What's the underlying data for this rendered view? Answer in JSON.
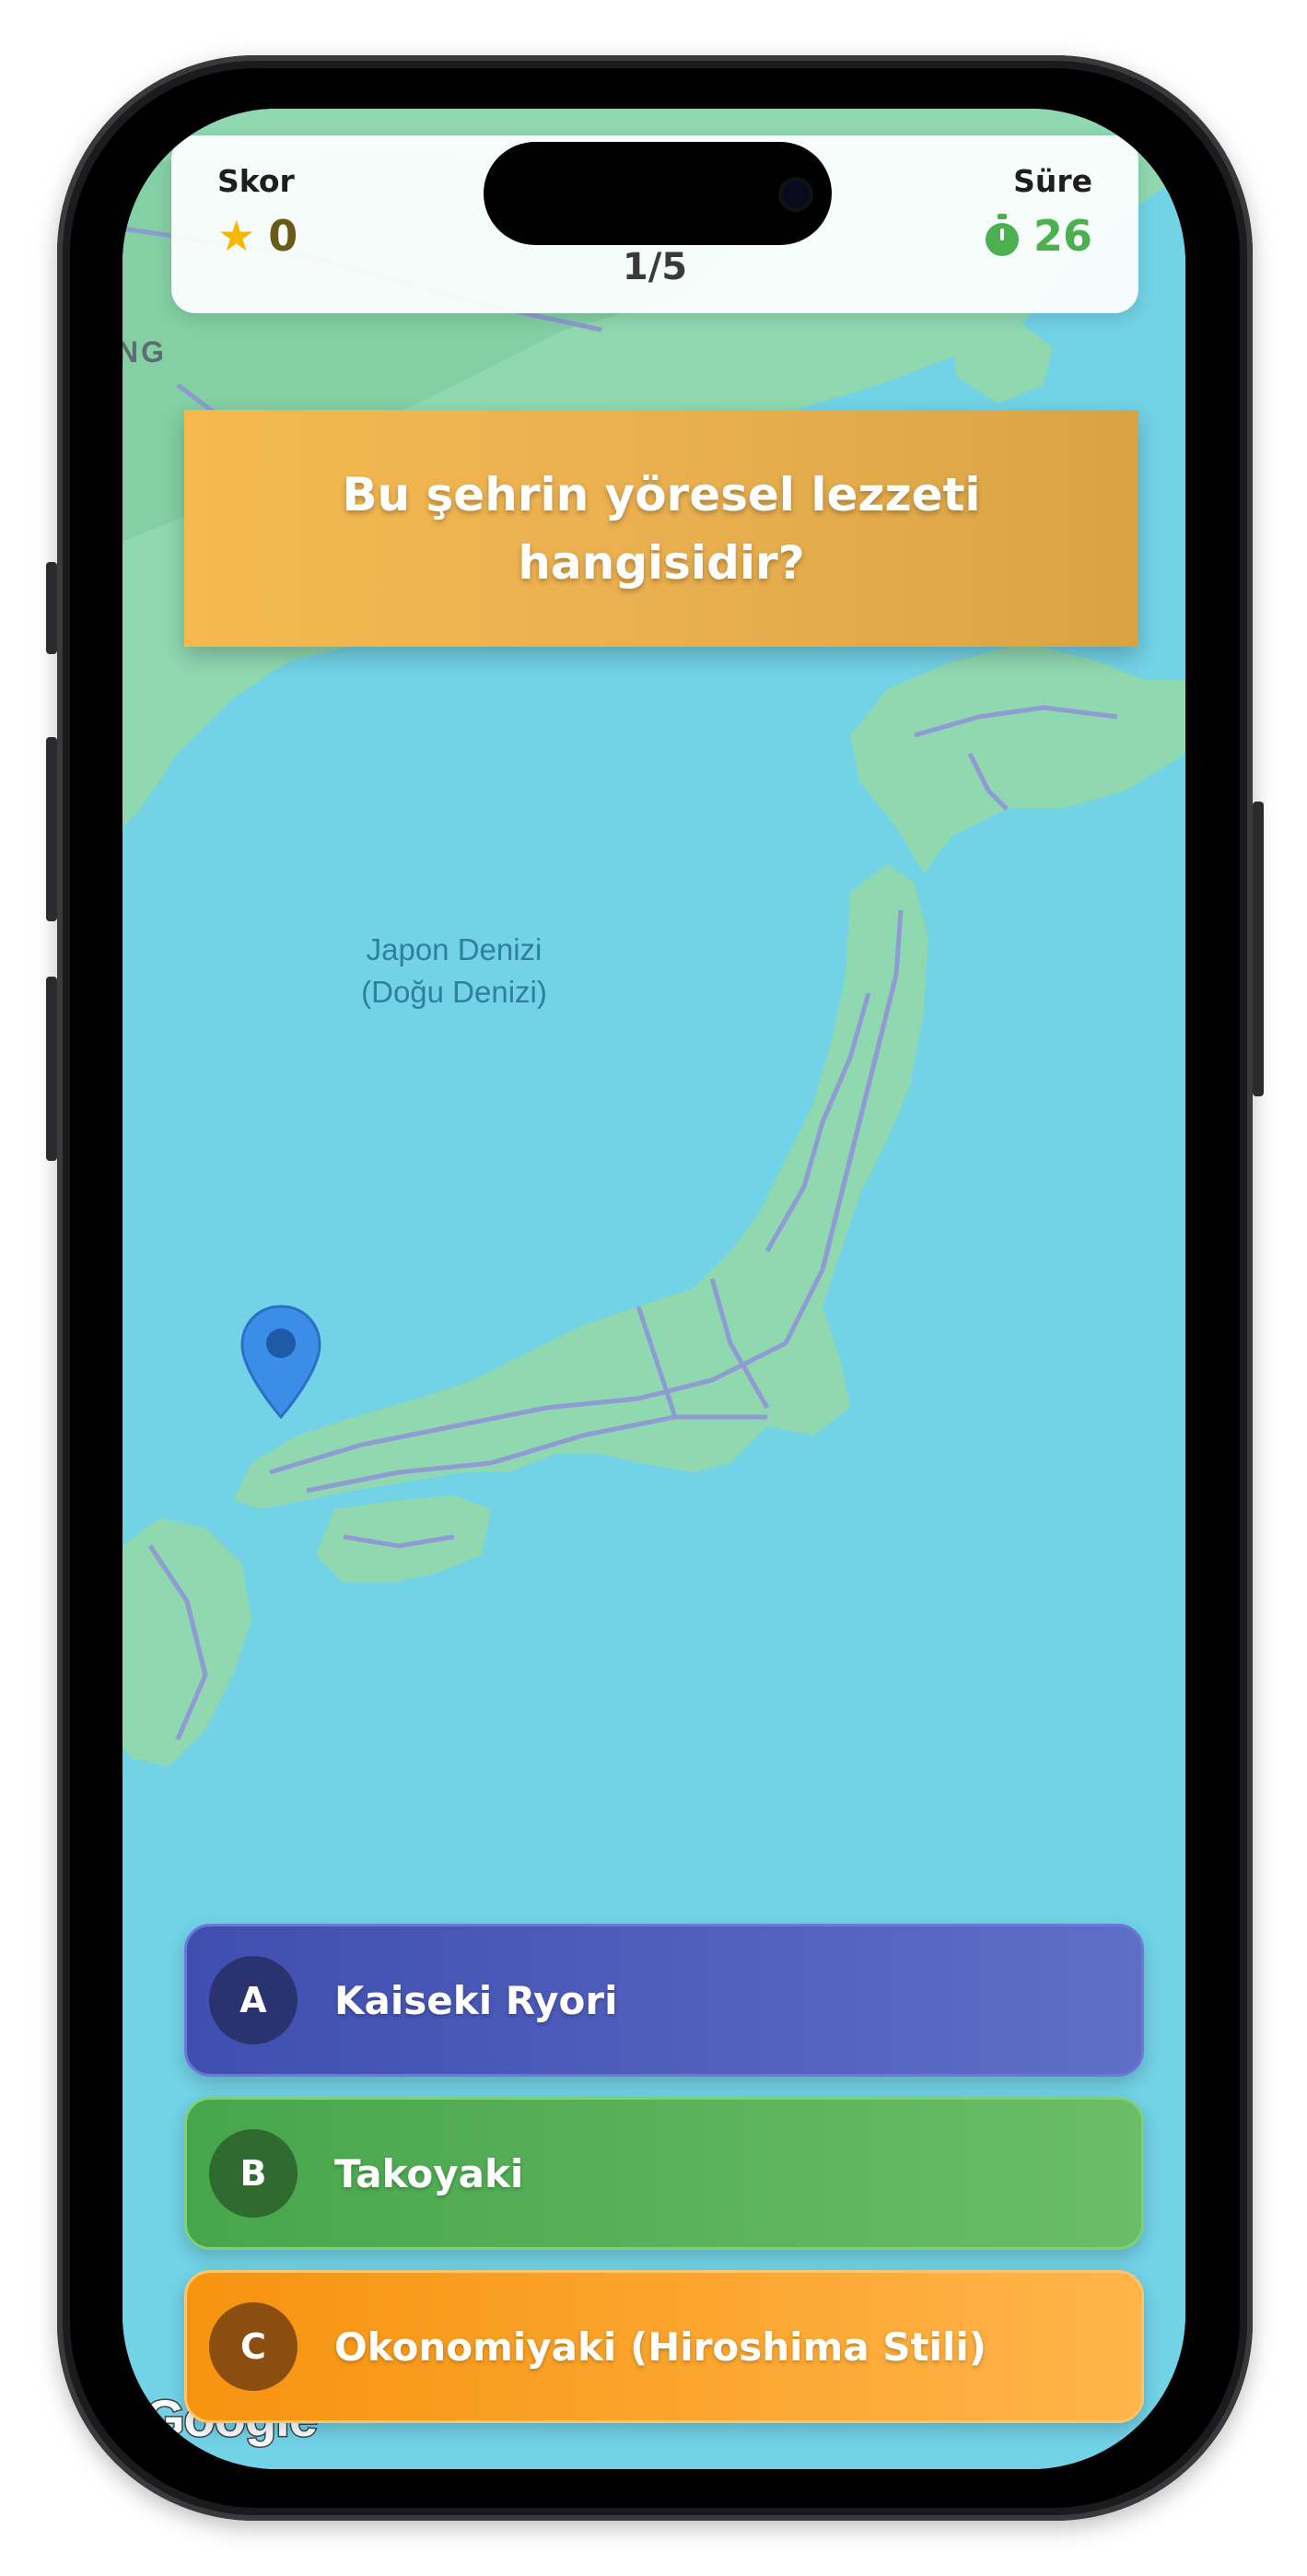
{
  "header": {
    "score_label": "Skor",
    "score_value": "0",
    "time_label": "Süre",
    "time_value": "26",
    "progress": "1/5",
    "score_icon": "star-icon",
    "time_icon": "stopwatch-icon"
  },
  "question": {
    "text": "Bu şehrin yöresel lezzeti hangisidir?"
  },
  "map": {
    "sea_label_line1": "Japon Denizi",
    "sea_label_line2": "(Doğu Denizi)",
    "region_label": "NG",
    "attribution": "Google",
    "marker_icon": "map-pin-icon"
  },
  "answers": [
    {
      "letter": "A",
      "label": "Kaiseki Ryori",
      "color": "#4a58bb"
    },
    {
      "letter": "B",
      "label": "Takoyaki",
      "color": "#57b057"
    },
    {
      "letter": "C",
      "label": "Okonomiyaki (Hiroshima Stili)",
      "color": "#fca22e"
    }
  ],
  "colors": {
    "sea": "#72d2e6",
    "land": "#8fd8b0",
    "roads": "#8f95d6",
    "question_bg": "#eab050",
    "timer": "#4caf50",
    "star": "#f5b800"
  }
}
